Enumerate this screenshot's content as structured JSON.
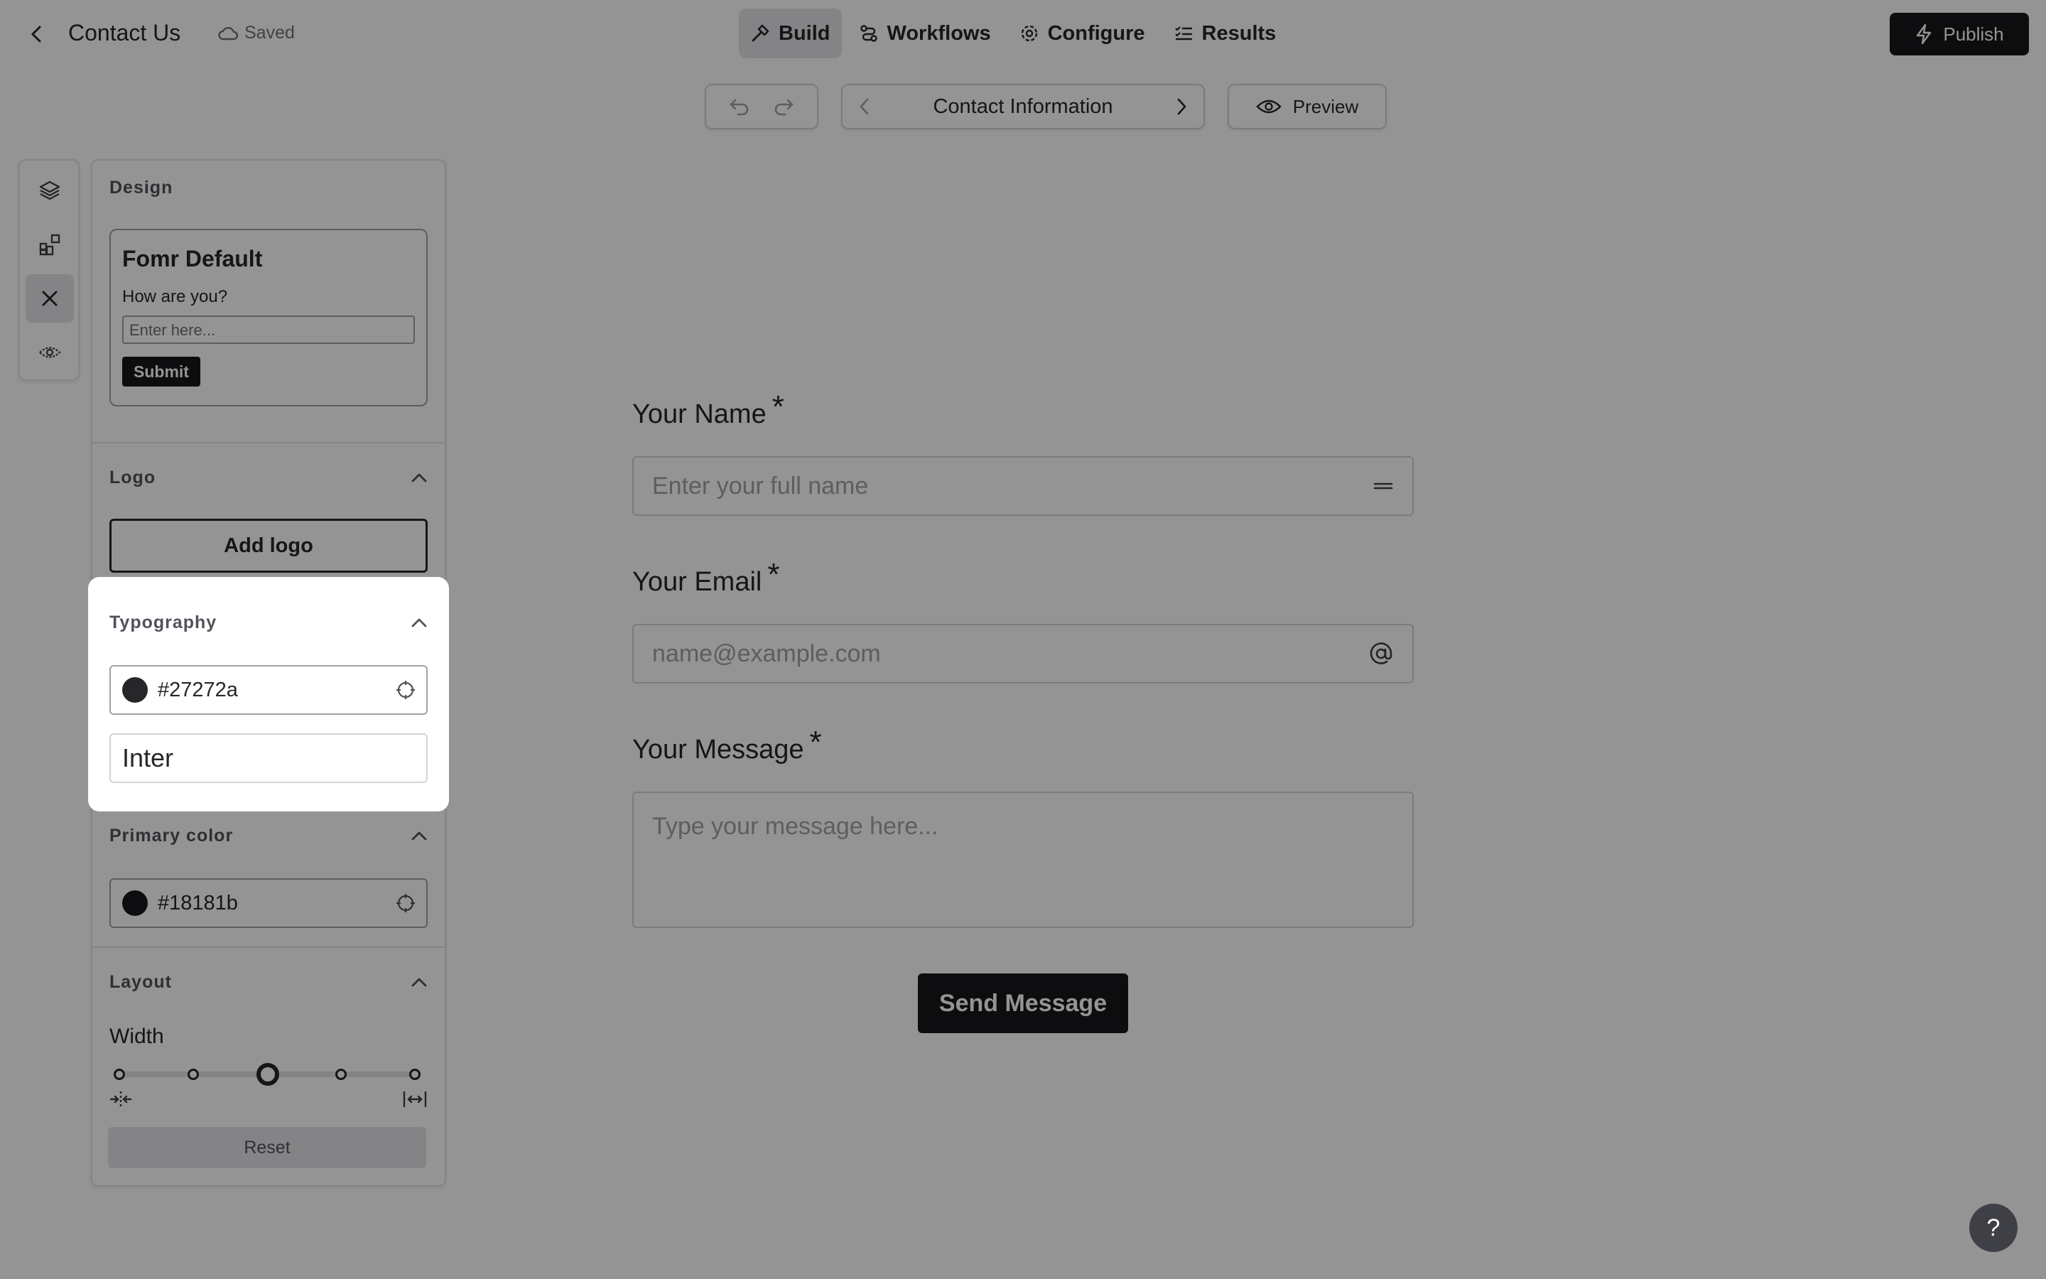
{
  "header": {
    "title": "Contact Us",
    "saved_status": "Saved",
    "nav": [
      {
        "label": "Build",
        "icon": "hammer-icon",
        "active": true
      },
      {
        "label": "Workflows",
        "icon": "workflow-icon",
        "active": false
      },
      {
        "label": "Configure",
        "icon": "gear-icon",
        "active": false
      },
      {
        "label": "Results",
        "icon": "list-check-icon",
        "active": false
      }
    ],
    "publish_label": "Publish"
  },
  "toolbar": {
    "current_page": "Contact Information",
    "preview_label": "Preview"
  },
  "rail": {
    "items": [
      {
        "icon": "layers-icon",
        "active": false
      },
      {
        "icon": "add-block-icon",
        "active": false
      },
      {
        "icon": "close-icon",
        "active": true
      },
      {
        "icon": "eye-settings-icon",
        "active": false
      }
    ]
  },
  "design_panel": {
    "title": "Design",
    "theme_preview": {
      "name": "Fomr Default",
      "question": "How are you?",
      "placeholder": "Enter here...",
      "submit_label": "Submit"
    },
    "logo": {
      "label": "Logo",
      "button_label": "Add logo"
    },
    "typography": {
      "label": "Typography",
      "color": "#27272a",
      "color_text": "#27272a",
      "font": "Inter"
    },
    "primary_color": {
      "label": "Primary color",
      "color": "#18181b",
      "color_text": "#18181b"
    },
    "layout": {
      "label": "Layout",
      "width_label": "Width",
      "width_steps": 5,
      "width_selected_index": 2,
      "reset_label": "Reset"
    }
  },
  "form": {
    "fields": [
      {
        "label": "Your Name",
        "required_mark": "*",
        "placeholder": "Enter your full name",
        "icon": "text-lines-icon"
      },
      {
        "label": "Your Email",
        "required_mark": "*",
        "placeholder": "name@example.com",
        "icon": "at-icon"
      },
      {
        "label": "Your Message",
        "required_mark": "*",
        "placeholder": "Type your message here..."
      }
    ],
    "submit_label": "Send Message"
  },
  "help_label": "?",
  "colors": {
    "accent": "#18181b",
    "text": "#27272a",
    "overlay": "rgba(0,0,0,0.42)"
  }
}
